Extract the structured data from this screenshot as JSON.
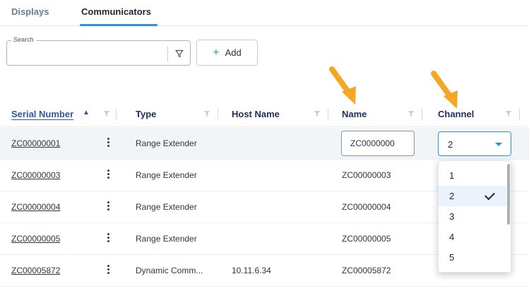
{
  "tabs": [
    {
      "label": "Displays"
    },
    {
      "label": "Communicators"
    }
  ],
  "search": {
    "label": "Search",
    "placeholder": ""
  },
  "toolbar": {
    "add_label": "Add"
  },
  "columns": {
    "serial": "Serial Number",
    "type": "Type",
    "host": "Host Name",
    "name": "Name",
    "channel": "Channel"
  },
  "rows": [
    {
      "serial": "ZC00000001",
      "type": "Range Extender",
      "host": "",
      "name": "ZC0000000",
      "channel": "2"
    },
    {
      "serial": "ZC00000003",
      "type": "Range Extender",
      "host": "",
      "name": "ZC00000003"
    },
    {
      "serial": "ZC00000004",
      "type": "Range Extender",
      "host": "",
      "name": "ZC00000004"
    },
    {
      "serial": "ZC00000005",
      "type": "Range Extender",
      "host": "",
      "name": "ZC00000005"
    },
    {
      "serial": "ZC00005872",
      "type": "Dynamic Comm...",
      "host": "10.11.6.34",
      "name": "ZC00005872"
    }
  ],
  "channel_dropdown": {
    "options": [
      "1",
      "2",
      "3",
      "4",
      "5"
    ],
    "selected": "2"
  },
  "colors": {
    "accent": "#2f8fe0",
    "arrow": "#f5a623",
    "link": "#2a5aa6"
  },
  "icons": {
    "filter": "filter-icon",
    "sort": "sort-icon",
    "kebab": "kebab-menu-icon",
    "plus": "plus-icon",
    "check": "check-icon",
    "caret": "chevron-down-icon",
    "arrow": "arrow-pointer-icon"
  }
}
